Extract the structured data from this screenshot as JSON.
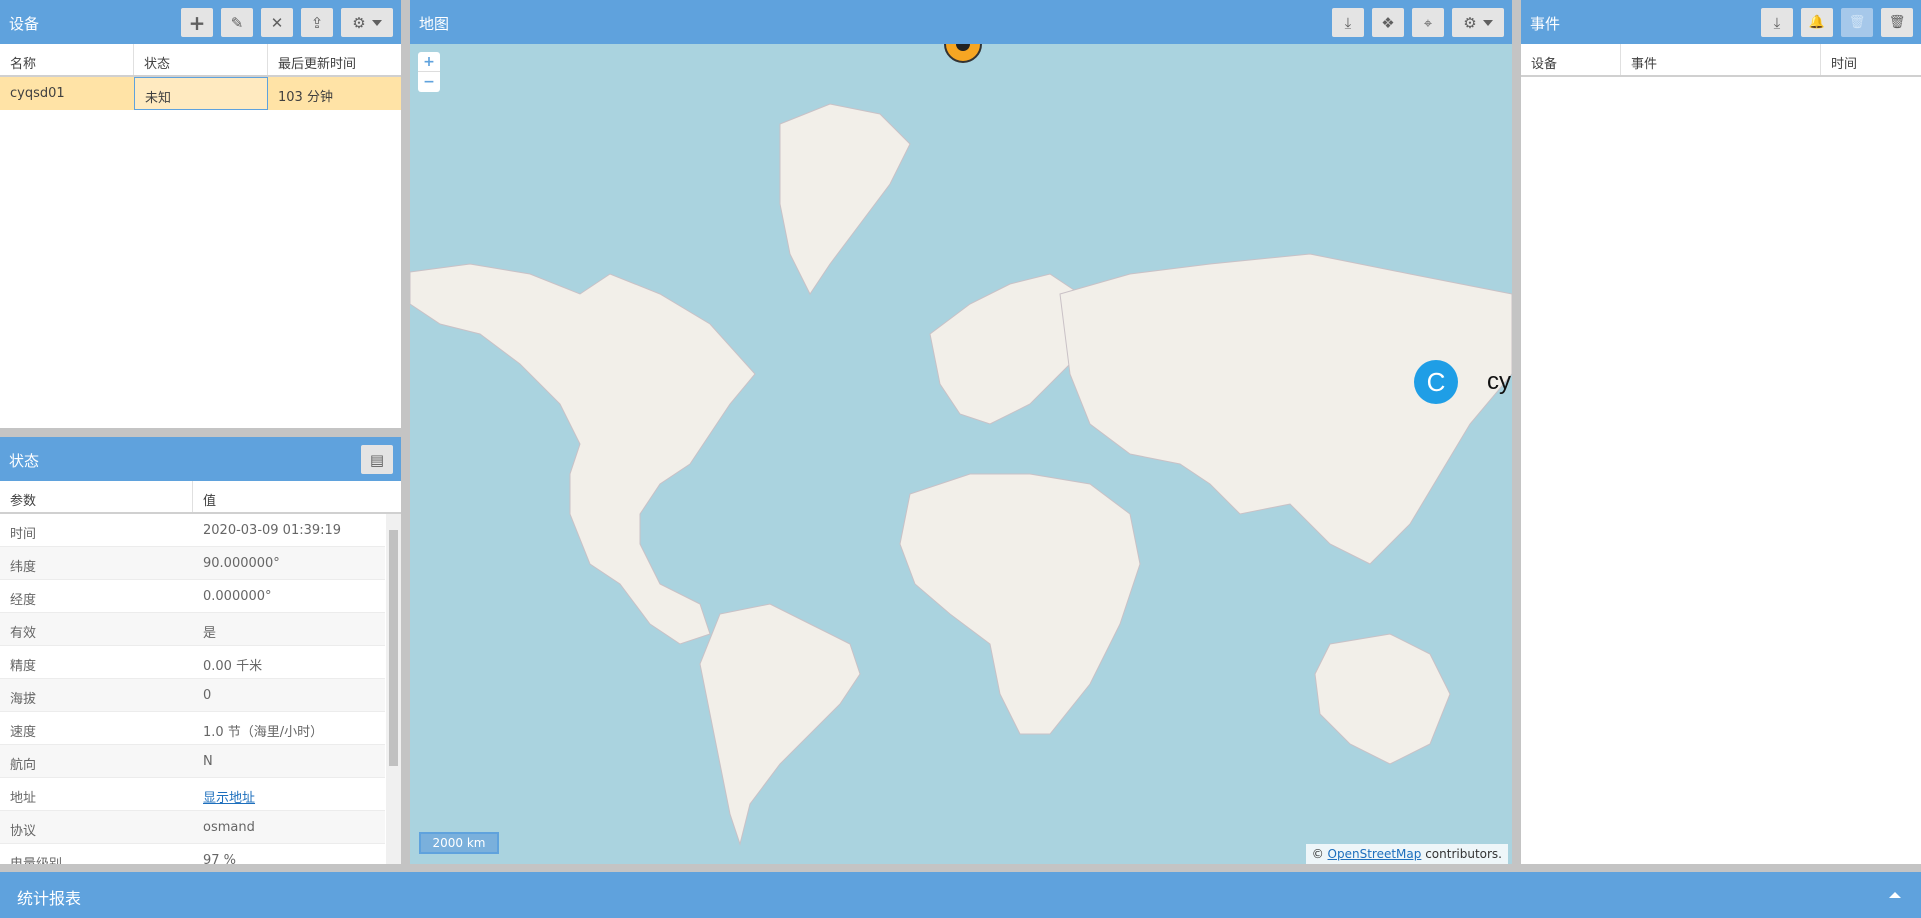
{
  "devices": {
    "title": "设备",
    "columns": [
      "名称",
      "状态",
      "最后更新时间"
    ],
    "rows": [
      {
        "name": "cyqsd01",
        "status": "未知",
        "last_update": "103 分钟"
      }
    ]
  },
  "state": {
    "title": "状态",
    "columns": [
      "参数",
      "值"
    ],
    "rows": [
      {
        "key": "时间",
        "value": "2020-03-09 01:39:19"
      },
      {
        "key": "纬度",
        "value": "90.000000°"
      },
      {
        "key": "经度",
        "value": "0.000000°"
      },
      {
        "key": "有效",
        "value": "是"
      },
      {
        "key": "精度",
        "value": "0.00 千米"
      },
      {
        "key": "海拔",
        "value": "0"
      },
      {
        "key": "速度",
        "value": "1.0 节（海里/小时）"
      },
      {
        "key": "航向",
        "value": "N"
      },
      {
        "key": "地址",
        "value": "显示地址"
      },
      {
        "key": "协议",
        "value": "osmand"
      },
      {
        "key": "电量级别",
        "value": "97 %"
      }
    ]
  },
  "map": {
    "title": "地图",
    "scale": "2000 km",
    "attribution_prefix": "©",
    "attribution_link": "OpenStreetMap",
    "attribution_suffix": "contributors.",
    "watermark": "cyqsd's blog",
    "watermark_logo": "C",
    "zoom_in": "+",
    "zoom_out": "−"
  },
  "events": {
    "title": "事件",
    "columns": [
      "设备",
      "事件",
      "时间"
    ]
  },
  "bottom": {
    "title": "统计报表"
  },
  "icons": {
    "add": "+",
    "edit": "✎",
    "remove": "✕",
    "upload": "⇪",
    "settings": "⚙",
    "table": "▤",
    "download": "⤓",
    "paw": "❖",
    "locate": "⌖",
    "bell": "🔔",
    "trash": "🗑"
  },
  "colors": {
    "accent": "#5fa2dd",
    "selected_row": "#ffe3a6",
    "ocean": "#aad3df",
    "land": "#f2efe9"
  }
}
